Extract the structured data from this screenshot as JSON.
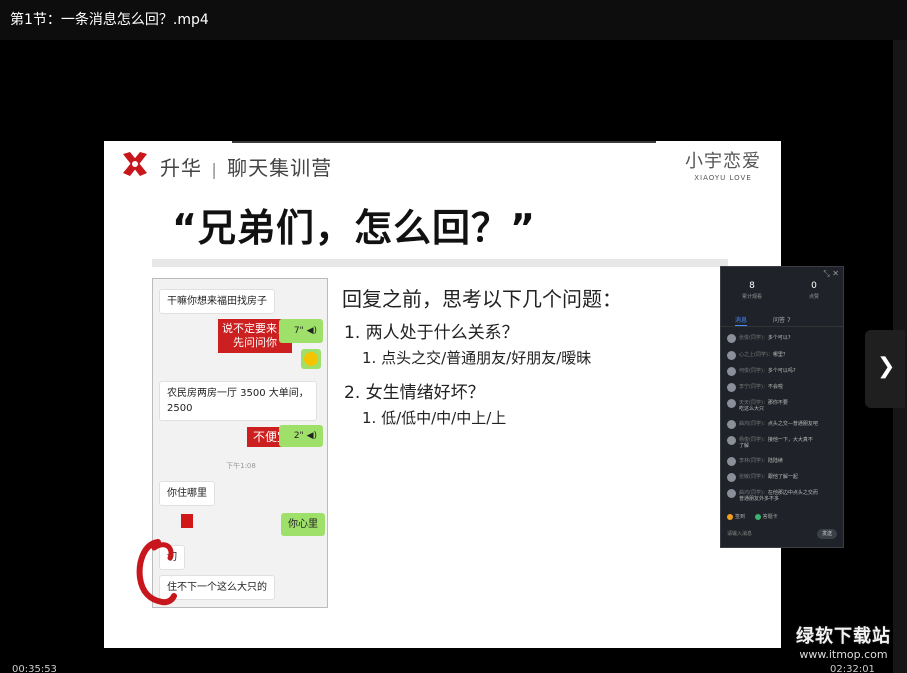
{
  "window": {
    "title": "第1节：一条消息怎么回？.mp4"
  },
  "player": {
    "time_current": "00:35:53",
    "time_total": "02:32:01",
    "next_icon": "chevron-right-icon",
    "watermark_name": "绿软下载站",
    "watermark_url": "www.itmop.com"
  },
  "slide": {
    "brand_a": "升华",
    "brand_sep": "|",
    "brand_b": "聊天集训营",
    "corner_cn": "小宇恋爱",
    "corner_en": "XIAOYU LOVE",
    "headline": "“兄弟们，怎么回？”",
    "accent_color": "#c8161d",
    "phone": {
      "m1": "干嘛你想来福田找房子",
      "m2_line1": "说不定要来，",
      "m2_line2": "先问问你",
      "voice1": "7\"",
      "m3_line1": "农民房两房一厅 3500 大单间，",
      "m3_line2": "2500",
      "m4": "不便宜啊",
      "voice2": "2\"",
      "time": "下午1:08",
      "m5": "你住哪里",
      "m6": "你心里",
      "m7": "切",
      "m8": "住不下一个这么大只的"
    },
    "questions": {
      "head": "回复之前，思考以下几个问题：",
      "q1": "1.  两人处于什么关系？",
      "q1a": "1. 点头之交/普通朋友/好朋友/暧昧",
      "q2": "2.  女生情绪好坏？",
      "q2a": "1. 低/低中/中/中上/上"
    }
  },
  "chat": {
    "stat1_num": "8",
    "stat1_label": "累计观看",
    "stat2_num": "0",
    "stat2_label": "点赞",
    "tab1": "消息",
    "tab2": "问答 7",
    "rows": [
      {
        "name": "张俊(同学)：",
        "text": "多个可以?"
      },
      {
        "name": "心之上(同学)：",
        "text": "哪里？"
      },
      {
        "name": "何俊(同学)：",
        "text": "多个可以吗?"
      },
      {
        "name": "李宁(同学)：",
        "text": "不会啦"
      },
      {
        "name": "天天(同学)：",
        "text": "那你不要",
        "text2": "吃这么大只"
      },
      {
        "name": "曲鸿(同学)：",
        "text": "点头之交—普通朋友吧"
      },
      {
        "name": "杨俊(同学)：",
        "text": "接他一下，大大真不",
        "text2": "了解"
      },
      {
        "name": "李林(同学)：",
        "text": "陆陆续"
      },
      {
        "name": "张敏(同学)：",
        "text": "跟他了解一起"
      },
      {
        "name": "曲鸿(同学)：",
        "text": "在他那边中点头之交而",
        "text2": "普通朋友外多不多"
      }
    ],
    "foot1": "签到",
    "foot2": "答题卡",
    "input_placeholder": "请输入消息",
    "send": "发送"
  }
}
